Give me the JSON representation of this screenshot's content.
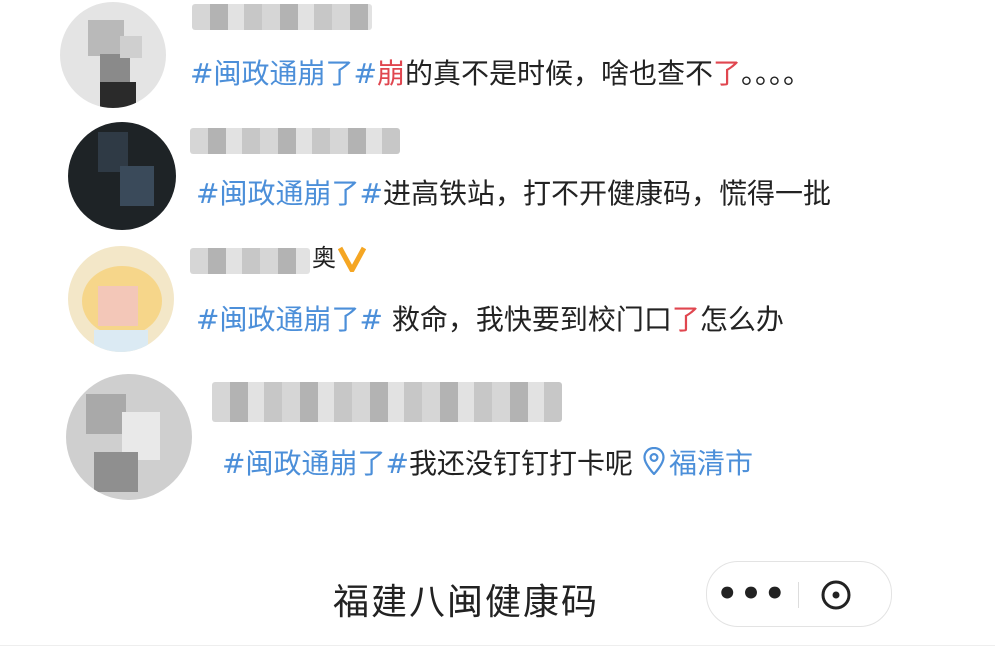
{
  "posts": [
    {
      "hashtag": "#闽政通崩了#",
      "text_parts": [
        "崩",
        "的真不是时候，啥也查不",
        "了",
        "。。。。"
      ]
    },
    {
      "hashtag": "#闽政通崩了#",
      "text": "进高铁站，打不开健康码，慌得一批"
    },
    {
      "hashtag": "#闽政通崩了#",
      "text_pre": " 救命，我快要到校门口",
      "text_red": "了",
      "text_post": "怎么办",
      "name_suffix": "奥"
    },
    {
      "hashtag": "#闽政通崩了#",
      "text": "我还没钉钉打卡呢",
      "location": "福清市"
    }
  ],
  "miniprogram": {
    "title": "福建八闽健康码",
    "more_label": "•••"
  },
  "colors": {
    "hashtag_blue": "#4c8fd9",
    "highlight_red": "#e0464f",
    "vip_orange": "#f5a623"
  },
  "icons": [
    "location-pin-icon",
    "vip-badge-icon",
    "more-dots-icon",
    "close-circle-icon"
  ]
}
